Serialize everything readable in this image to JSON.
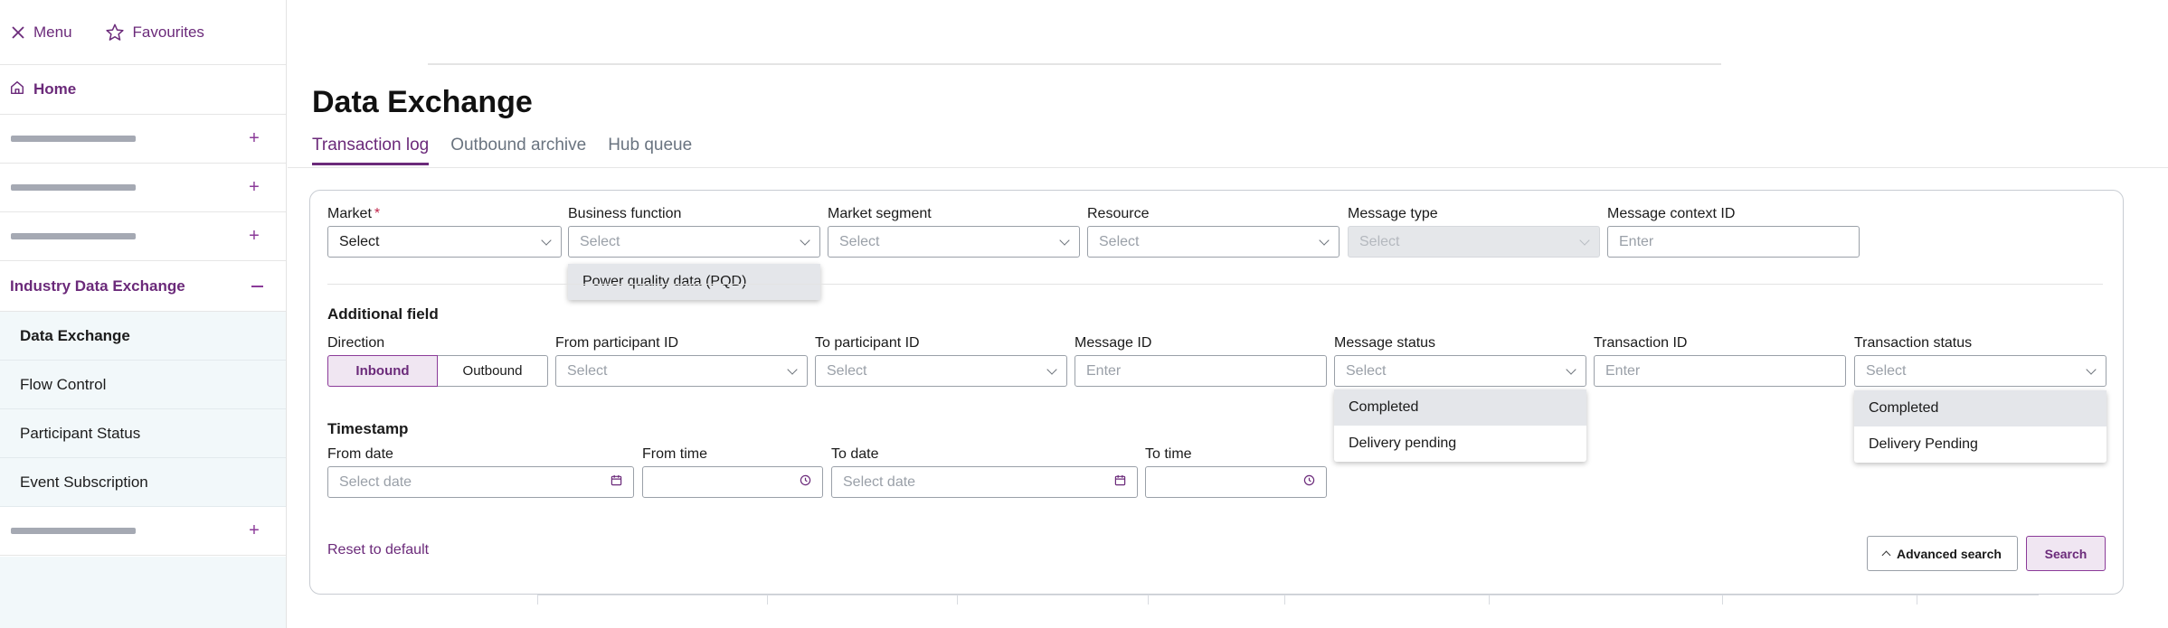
{
  "topbar": {
    "menu_label": "Menu",
    "favourites_label": "Favourites"
  },
  "sidebar": {
    "home_label": "Home",
    "section_label": "Industry Data Exchange",
    "sub_items": [
      "Data Exchange",
      "Flow Control",
      "Participant Status",
      "Event Subscription"
    ],
    "active_sub_item": "Data Exchange"
  },
  "page": {
    "title": "Data Exchange",
    "tabs": [
      "Transaction log",
      "Outbound archive",
      "Hub queue"
    ],
    "active_tab": "Transaction log"
  },
  "filters": {
    "market": {
      "label": "Market",
      "required_mark": "*",
      "value": "Select"
    },
    "business_function": {
      "label": "Business function",
      "placeholder": "Select",
      "option": "Power quality data (PQD)"
    },
    "market_segment": {
      "label": "Market segment",
      "placeholder": "Select"
    },
    "resource": {
      "label": "Resource",
      "placeholder": "Select"
    },
    "message_type": {
      "label": "Message type",
      "placeholder": "Select"
    },
    "message_context_id": {
      "label": "Message context ID",
      "placeholder": "Enter"
    }
  },
  "additional": {
    "title": "Additional field",
    "direction": {
      "label": "Direction",
      "options": [
        "Inbound",
        "Outbound"
      ],
      "selected": "Inbound"
    },
    "from_participant_id": {
      "label": "From participant ID",
      "placeholder": "Select"
    },
    "to_participant_id": {
      "label": "To participant ID",
      "placeholder": "Select"
    },
    "message_id": {
      "label": "Message ID",
      "placeholder": "Enter"
    },
    "message_status": {
      "label": "Message status",
      "placeholder": "Select",
      "options": [
        "Completed",
        "Delivery pending"
      ]
    },
    "transaction_id": {
      "label": "Transaction ID",
      "placeholder": "Enter"
    },
    "transaction_status": {
      "label": "Transaction status",
      "placeholder": "Select",
      "options": [
        "Completed",
        "Delivery Pending"
      ]
    }
  },
  "timestamp": {
    "title": "Timestamp",
    "from_date": {
      "label": "From date",
      "placeholder": "Select date"
    },
    "from_time": {
      "label": "From time",
      "placeholder": ""
    },
    "to_date": {
      "label": "To date",
      "placeholder": "Select date"
    },
    "to_time": {
      "label": "To time",
      "placeholder": ""
    }
  },
  "actions": {
    "reset_label": "Reset to default",
    "advanced_label": "Advanced search",
    "search_label": "Search"
  },
  "colors": {
    "brand": "#6b2a7a",
    "sidebar_sub_bg": "#f2f8fa",
    "required": "#c0254a"
  }
}
